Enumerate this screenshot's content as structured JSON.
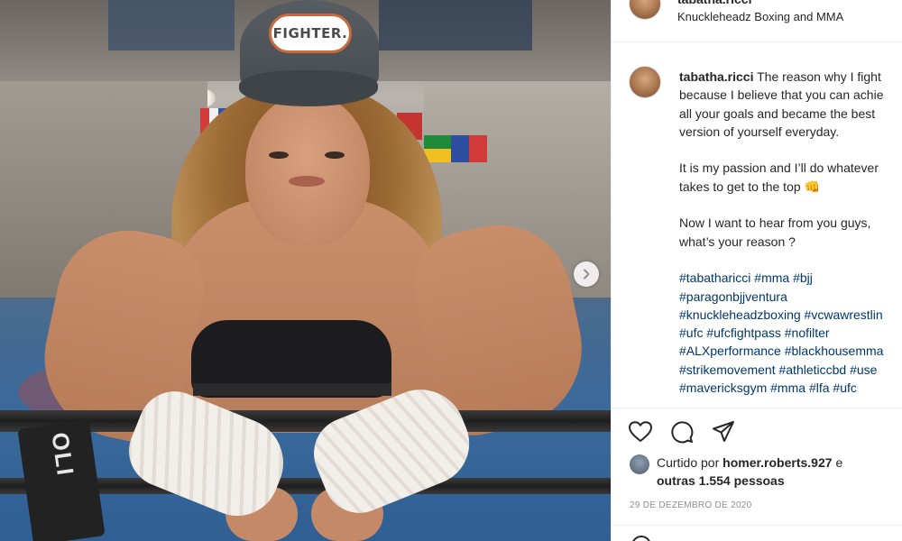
{
  "post": {
    "username": "tabatha.ricci",
    "location": "Knuckleheadz Boxing and MMA",
    "cap_text": "FIGHTER.",
    "strap_text": "OLI",
    "caption_lines": [
      "The reason why I fight",
      "because I believe that you can achie",
      "all your goals and became the best",
      "version of yourself everyday.",
      "",
      "It is my passion and I’ll do whatever",
      "takes to get to the top 👊",
      "",
      "Now I want to hear from you guys,",
      "what’s your reason ?",
      ""
    ],
    "hashtag_lines": [
      [
        "#tabatharicci",
        "#mma",
        "#bjj"
      ],
      [
        "#paragonbjjventura"
      ],
      [
        "#knuckleheadzboxing",
        "#vcwawrestlin"
      ],
      [
        "#ufc",
        "#ufcfightpass",
        "#nofilter"
      ],
      [
        "#ALXperformance",
        "#blackhousemma"
      ],
      [
        "#strikemovement",
        "#athleticcbd",
        "#use"
      ],
      [
        "#mavericksgym",
        "#mma",
        "#lfa",
        "#ufc"
      ]
    ],
    "likes": {
      "prefix": "Curtido por",
      "user": "homer.roberts.927",
      "connector": "e",
      "others": "outras 1.554 pessoas"
    },
    "date": "29 DE DEZEMBRO DE 2020"
  },
  "icons": {
    "like": "heart-icon",
    "comment": "comment-icon",
    "share": "send-icon",
    "next": "chevron-right-icon"
  },
  "colors": {
    "hashtag": "#00376b",
    "text": "#262626",
    "muted": "#8e8e8e"
  }
}
